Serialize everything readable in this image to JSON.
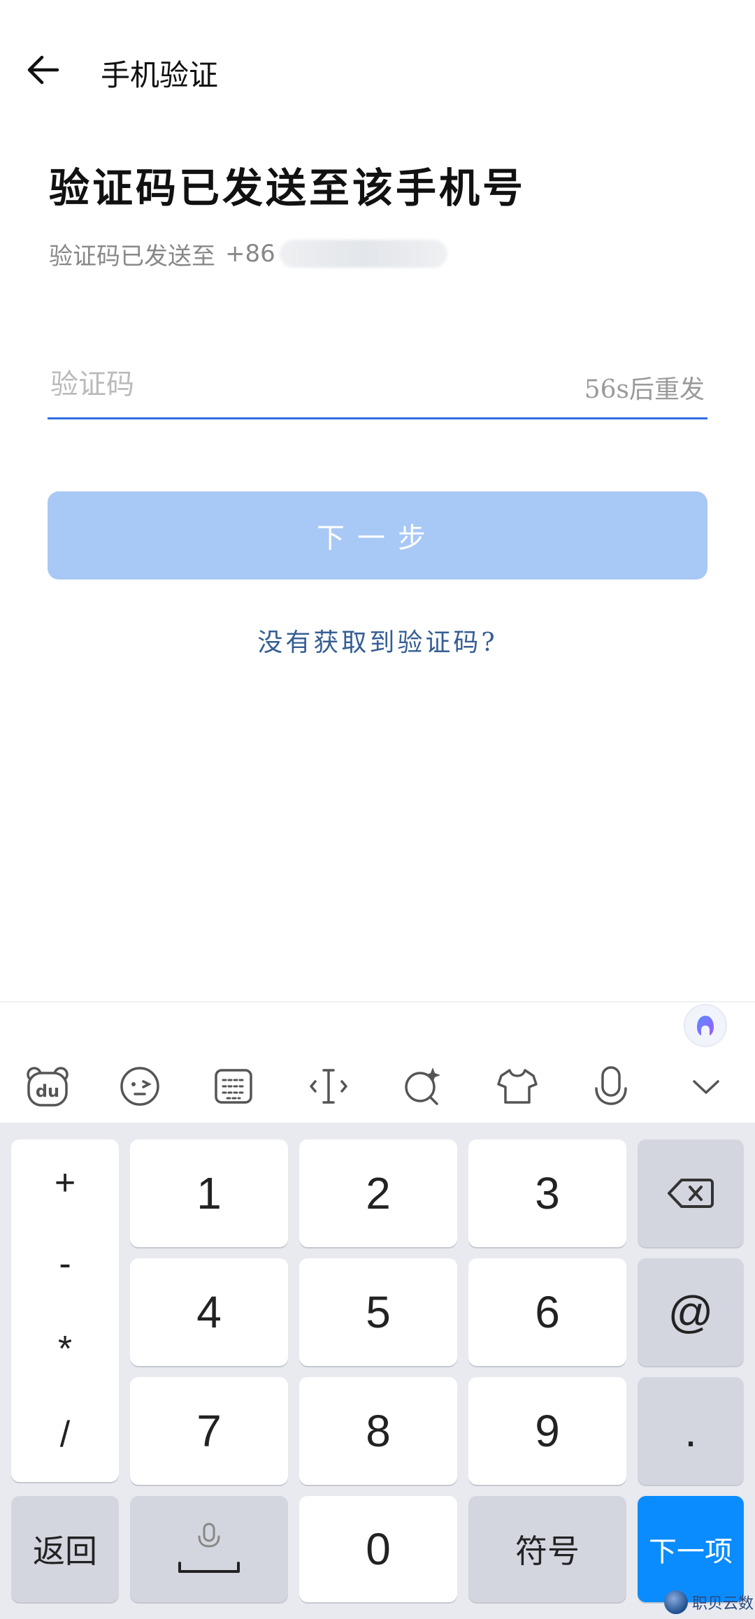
{
  "header": {
    "title": "手机验证"
  },
  "main": {
    "title": "验证码已发送至该手机号",
    "subtitle": "验证码已发送至",
    "phone_prefix": "+86",
    "code_placeholder": "验证码",
    "resend_label": "56s后重发",
    "next_label": "下一步",
    "no_code_link": "没有获取到验证码?"
  },
  "keyboard": {
    "toolbar_icons": [
      "du-bear-icon",
      "emoji-icon",
      "keyboard-layout-icon",
      "text-cursor-icon",
      "search-sparkle-icon",
      "skin-shirt-icon",
      "microphone-icon",
      "collapse-keyboard-icon"
    ],
    "symbols": [
      "+",
      "-",
      "*",
      "/"
    ],
    "keys": {
      "k1": "1",
      "k2": "2",
      "k3": "3",
      "k4": "4",
      "k5": "5",
      "k6": "6",
      "k7": "7",
      "k8": "8",
      "k9": "9",
      "k0": "0",
      "at": "@",
      "dot": ".",
      "back": "返回",
      "symbol": "符号",
      "next": "下一项"
    }
  },
  "watermark": {
    "text": "职贝云数"
  },
  "colors": {
    "accent": "#2f6ee0",
    "button_disabled": "#a8c8f5",
    "link": "#355e93",
    "key_blue": "#0a8cff",
    "keyboard_bg": "#e8eaf0"
  }
}
